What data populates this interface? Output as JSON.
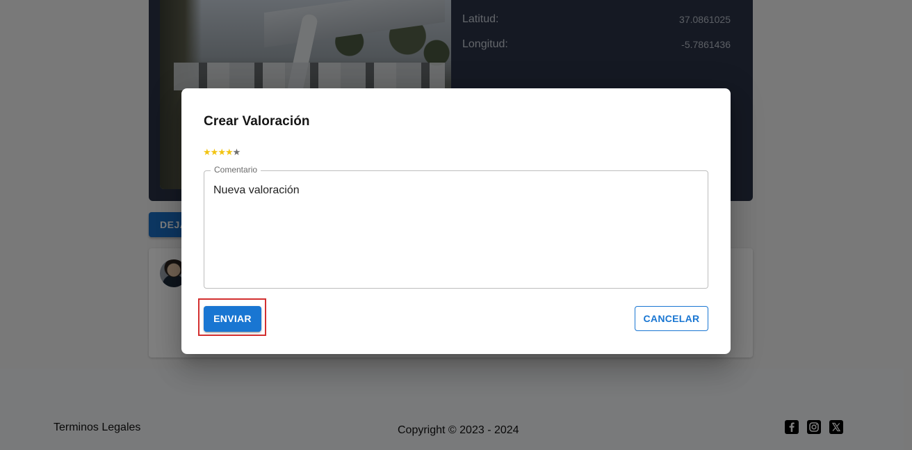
{
  "station": {
    "latitude_label": "Latitud:",
    "latitude_value": "37.0861025",
    "longitude_label": "Longitud:",
    "longitude_value": "-5.7861436"
  },
  "reviews": {
    "leave_review_label": "DEJAR VALORACIÓN"
  },
  "footer": {
    "legal_link": "Terminos Legales",
    "copyright": "Copyright © 2023 - 2024",
    "social_icons": [
      "facebook-icon",
      "instagram-icon",
      "x-icon"
    ]
  },
  "dialog": {
    "title": "Crear Valoración",
    "rating": {
      "value": 4,
      "max": 5,
      "filled_color": "#f2c413",
      "empty_color": "#6f6f6f"
    },
    "comment": {
      "label": "Comentario",
      "value": "Nueva valoración"
    },
    "send_label": "ENVIAR",
    "cancel_label": "CANCELAR",
    "primary_color": "#1976d2",
    "highlight_color": "#d32f2f"
  }
}
